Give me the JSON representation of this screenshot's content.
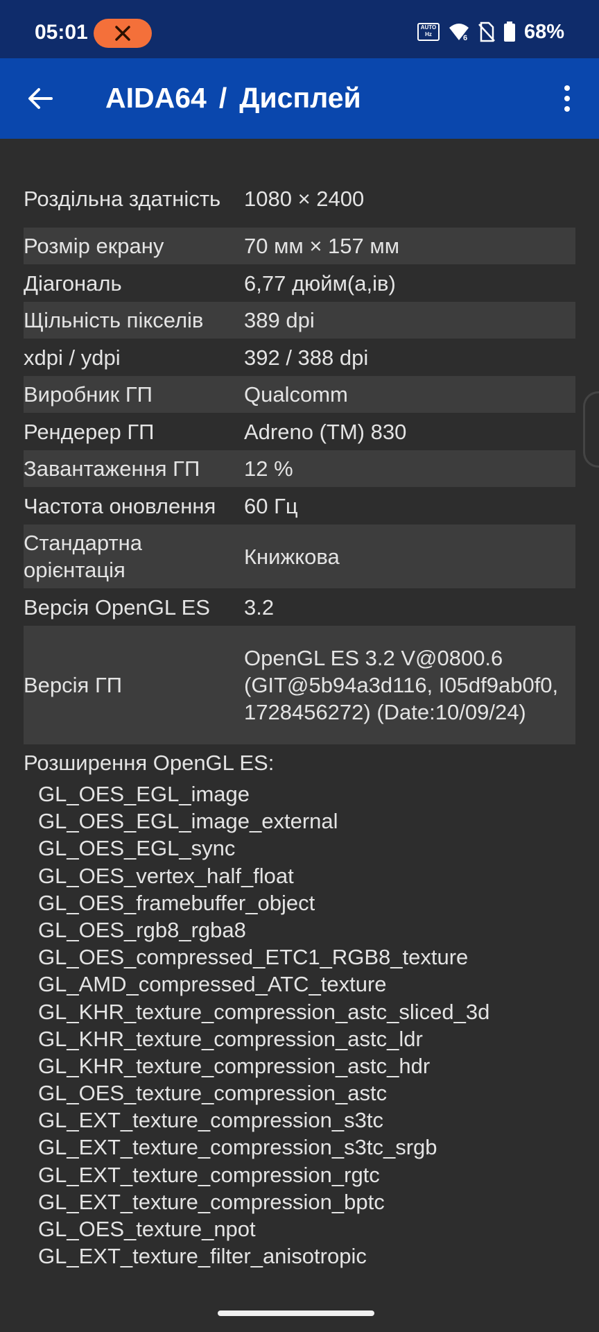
{
  "status_bar": {
    "time": "05:01",
    "x_badge": "X",
    "auto_hz": "AUTO\nHz",
    "wifi_label": "6",
    "battery_percent": "68%"
  },
  "app_bar": {
    "app_name": "AIDA64",
    "separator": "/",
    "section": "Дисплей"
  },
  "info_rows": [
    {
      "label": "Роздільна здатність",
      "value": "1080 × 2400"
    },
    {
      "label": "Розмір екрану",
      "value": "70 мм × 157 мм"
    },
    {
      "label": "Діагональ",
      "value": "6,77 дюйм(а,ів)"
    },
    {
      "label": "Щільність пікселів",
      "value": "389 dpi"
    },
    {
      "label": "xdpi / ydpi",
      "value": "392 / 388 dpi"
    },
    {
      "label": "Виробник ГП",
      "value": "Qualcomm"
    },
    {
      "label": "Рендерер ГП",
      "value": "Adreno (TM) 830"
    },
    {
      "label": "Завантаження ГП",
      "value": "12 %"
    },
    {
      "label": "Частота оновлення",
      "value": "60 Гц"
    },
    {
      "label": "Стандартна орієнтація",
      "value": "Книжкова"
    },
    {
      "label": "Версія OpenGL ES",
      "value": "3.2"
    },
    {
      "label": "Версія ГП",
      "value": "OpenGL ES 3.2 V@0800.6 (GIT@5b94a3d116, I05df9ab0f0, 1728456272) (Date:10/09/24)"
    }
  ],
  "extensions": {
    "header": "Розширення OpenGL ES:",
    "items": [
      "GL_OES_EGL_image",
      "GL_OES_EGL_image_external",
      "GL_OES_EGL_sync",
      "GL_OES_vertex_half_float",
      "GL_OES_framebuffer_object",
      "GL_OES_rgb8_rgba8",
      "GL_OES_compressed_ETC1_RGB8_texture",
      "GL_AMD_compressed_ATC_texture",
      "GL_KHR_texture_compression_astc_sliced_3d",
      "GL_KHR_texture_compression_astc_ldr",
      "GL_KHR_texture_compression_astc_hdr",
      "GL_OES_texture_compression_astc",
      "GL_EXT_texture_compression_s3tc",
      "GL_EXT_texture_compression_s3tc_srgb",
      "GL_EXT_texture_compression_rgtc",
      "GL_EXT_texture_compression_bptc",
      "GL_OES_texture_npot",
      "GL_EXT_texture_filter_anisotropic"
    ]
  },
  "icons": {
    "back": "arrow-left-icon",
    "menu": "more-vertical-icon",
    "wifi": "wifi-icon",
    "no_sim": "no-sim-icon",
    "battery": "battery-icon"
  },
  "colors": {
    "status_bar_bg": "#0f2c6b",
    "app_bar_bg": "#0a47ad",
    "content_bg": "#2d2d2d",
    "alt_row_bg": "#3d3d3d",
    "x_badge_bg": "#f4703a"
  }
}
